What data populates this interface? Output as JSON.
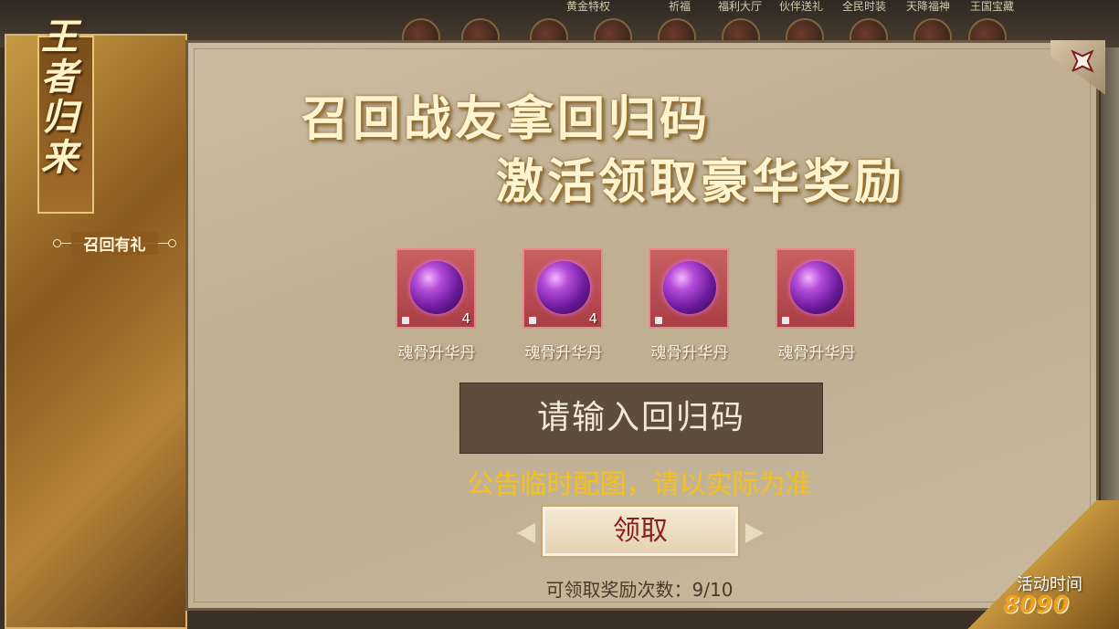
{
  "topbar": {
    "tabs": [
      "黄金特权",
      "祈福",
      "福利大厅",
      "伙伴送礼",
      "全民时装",
      "天降福神",
      "王国宝藏"
    ]
  },
  "sidebar": {
    "title_chars": [
      "王",
      "者",
      "归",
      "来"
    ],
    "items": [
      {
        "label": "召回有礼"
      }
    ]
  },
  "panel": {
    "heading_line1": "召回战友拿回归码",
    "heading_line2": "激活领取豪华奖励",
    "rewards": [
      {
        "name": "魂骨升华丹",
        "count": "4",
        "locked": true
      },
      {
        "name": "魂骨升华丹",
        "count": "4",
        "locked": true
      },
      {
        "name": "魂骨升华丹",
        "count": "",
        "locked": true
      },
      {
        "name": "魂骨升华丹",
        "count": "",
        "locked": true
      }
    ],
    "code_input_placeholder": "请输入回归码",
    "notice": "公告临时配图，请以实际为准",
    "claim_button": "领取",
    "claim_count": "可领取奖励次数：9/10",
    "activity_time_label": "活动时间"
  },
  "watermark": "8090",
  "colors": {
    "notice": "#f6c01a",
    "claim_text": "#8a1f1f",
    "reward_slot": "#b84a50",
    "orb": "#9b30c8"
  }
}
